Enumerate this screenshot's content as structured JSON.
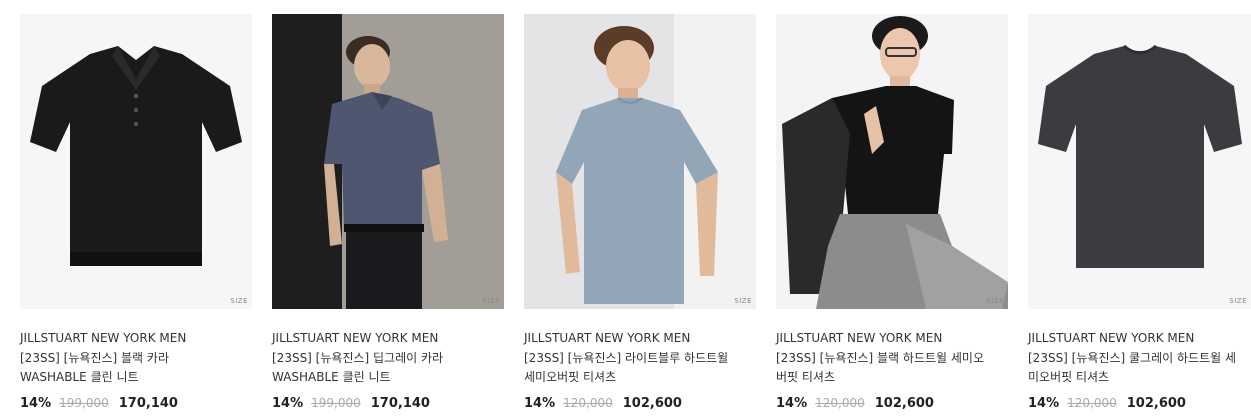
{
  "products": [
    {
      "brand": "JILLSTUART NEW YORK MEN",
      "name": "[23SS] [뉴욕진스] 블랙 카라 WASHABLE 클린 니트",
      "size_tag": "SIZE",
      "discount": "14%",
      "original_price": "199,000",
      "sale_price": "170,140",
      "image": "black-polo-knit-flatlay",
      "color": "#1a1a1a"
    },
    {
      "brand": "JILLSTUART NEW YORK MEN",
      "name": "[23SS] [뉴욕진스] 딥그레이 카라 WASHABLE 클린 니트",
      "size_tag": "SIZE",
      "discount": "14%",
      "original_price": "199,000",
      "sale_price": "170,140",
      "image": "model-deep-gray-polo",
      "color": "#4e5670"
    },
    {
      "brand": "JILLSTUART NEW YORK MEN",
      "name": "[23SS] [뉴욕진스] 라이트블루 하드트윌 세미오버핏 티셔츠",
      "size_tag": "SIZE",
      "discount": "14%",
      "original_price": "120,000",
      "sale_price": "102,600",
      "image": "model-light-blue-tshirt",
      "color": "#93a6b8"
    },
    {
      "brand": "JILLSTUART NEW YORK MEN",
      "name": "[23SS] [뉴욕진스] 블랙 하드트윌 세미오버핏 티셔츠",
      "size_tag": "SIZE",
      "discount": "14%",
      "original_price": "120,000",
      "sale_price": "102,600",
      "image": "model-black-tshirt-leather-jacket",
      "color": "#141414"
    },
    {
      "brand": "JILLSTUART NEW YORK MEN",
      "name": "[23SS] [뉴욕진스] 쿨그레이 하드트윌 세미오버핏 티셔츠",
      "size_tag": "SIZE",
      "discount": "14%",
      "original_price": "120,000",
      "sale_price": "102,600",
      "image": "cool-gray-tshirt-flatlay",
      "color": "#3a3c40"
    }
  ]
}
